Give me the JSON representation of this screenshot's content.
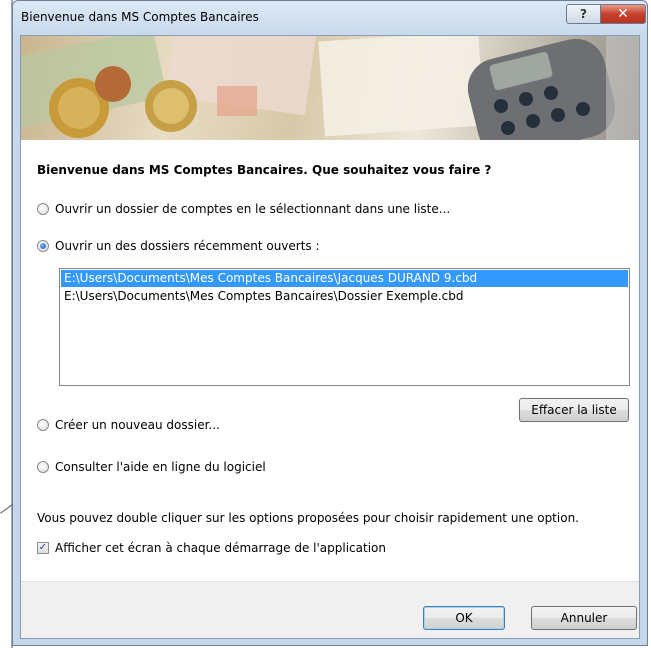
{
  "window": {
    "title": "Bienvenue dans MS Comptes Bancaires",
    "help_button": "?",
    "close_button": "✕"
  },
  "main": {
    "heading": "Bienvenue dans MS Comptes Bancaires. Que souhaitez vous faire ?",
    "options": [
      {
        "label": "Ouvrir un dossier de comptes en le sélectionnant dans une liste...",
        "selected": false
      },
      {
        "label": "Ouvrir un des dossiers récemment ouverts :",
        "selected": true
      },
      {
        "label": "Créer un nouveau dossier...",
        "selected": false
      },
      {
        "label": "Consulter l'aide en ligne du logiciel",
        "selected": false
      }
    ],
    "recent_files": [
      {
        "path": "E:\\Users\\Documents\\Mes Comptes Bancaires\\Jacques DURAND 9.cbd",
        "selected": true
      },
      {
        "path": "E:\\Users\\Documents\\Mes Comptes Bancaires\\Dossier Exemple.cbd",
        "selected": false
      }
    ],
    "clear_list_label": "Effacer la liste",
    "note": "Vous pouvez double cliquer sur les options proposées pour choisir rapidement une option.",
    "show_at_startup": {
      "label": "Afficher cet écran à chaque démarrage de l'application",
      "checked": true
    }
  },
  "footer": {
    "ok_label": "OK",
    "cancel_label": "Annuler"
  },
  "colors": {
    "selection": "#3399ff",
    "radio_dot": "#1553b7",
    "close_button": "#c6412d"
  }
}
